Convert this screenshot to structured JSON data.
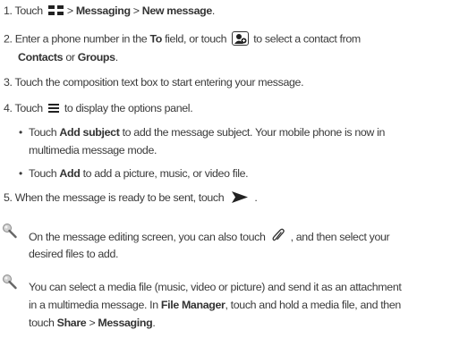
{
  "steps": {
    "s1": {
      "num": "1. Touch",
      "sep1": ">",
      "messaging": "Messaging",
      "sep2": ">",
      "new_message": "New message",
      "end": "."
    },
    "s2": {
      "a": "2. Enter a phone number in the",
      "to": "To",
      "b": "field, or touch",
      "c": "to select a contact from",
      "contacts": "Contacts",
      "or": "or",
      "groups": "Groups",
      "end": "."
    },
    "s3": {
      "text": "3. Touch the composition text box to start entering your message."
    },
    "s4": {
      "a": "4. Touch",
      "b": "to display the options panel."
    },
    "b1": {
      "bullet": "•",
      "a": "Touch",
      "add_subject": "Add subject",
      "b": "to add the message subject. Your mobile phone is now in",
      "c": "multimedia message mode."
    },
    "b2": {
      "bullet": "•",
      "a": "Touch",
      "add": "Add",
      "b": "to add a picture, music, or video file."
    },
    "s5": {
      "a": "5. When the message is ready to be sent, touch",
      "end": "."
    }
  },
  "tips": {
    "t1": {
      "a": "On the message editing screen, you can also touch",
      "b": ", and then select your",
      "c": "desired files to add."
    },
    "t2": {
      "a": "You can select a media file (music, video or picture) and send it as an attachment",
      "b": "in a multimedia message. In",
      "file_manager": "File Manager",
      "c": ", touch and hold a media file, and then",
      "d": "touch",
      "share": "Share",
      "sep": ">",
      "messaging": "Messaging",
      "end": "."
    }
  },
  "icons": [
    "apps-grid-icon",
    "add-contact-icon",
    "menu-icon",
    "send-icon",
    "paperclip-icon",
    "tip-icon"
  ]
}
